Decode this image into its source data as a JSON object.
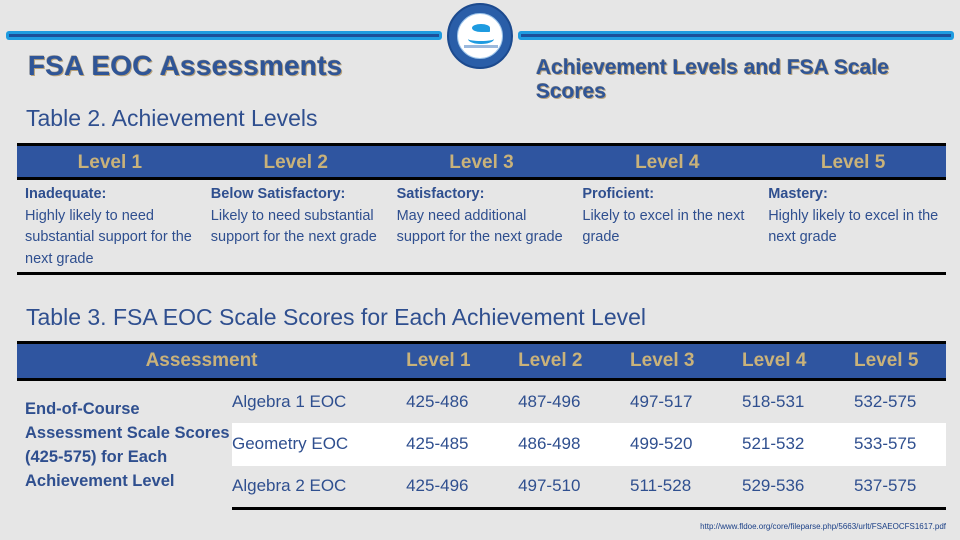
{
  "header": {
    "left_title": "FSA EOC Assessments",
    "right_title": "Achievement Levels and FSA Scale Scores",
    "logo": "school-district-seal-icon"
  },
  "table2": {
    "caption": "Table 2. Achievement Levels",
    "columns": [
      "Level 1",
      "Level 2",
      "Level 3",
      "Level 4",
      "Level 5"
    ],
    "cells": [
      {
        "label": "Inadequate:",
        "text": "Highly likely to need substantial support for the next grade"
      },
      {
        "label": "Below Satisfactory:",
        "text": "Likely to need substantial support for the next grade"
      },
      {
        "label": "Satisfactory:",
        "text": "May need additional support for the next grade"
      },
      {
        "label": "Proficient:",
        "text": "Likely to excel in the next grade"
      },
      {
        "label": "Mastery:",
        "text": "Highly likely to excel in the next grade"
      }
    ]
  },
  "table3": {
    "caption": "Table 3. FSA EOC Scale Scores for Each Achievement Level",
    "columns": [
      "Assessment",
      "Level 1",
      "Level 2",
      "Level 3",
      "Level 4",
      "Level 5"
    ],
    "group_label": "End-of-Course Assessment Scale Scores (425-575) for Each Achievement Level",
    "rows": [
      {
        "course": "Algebra 1 EOC",
        "scores": [
          "425-486",
          "487-496",
          "497-517",
          "518-531",
          "532-575"
        ]
      },
      {
        "course": "Geometry EOC",
        "scores": [
          "425-485",
          "486-498",
          "499-520",
          "521-532",
          "533-575"
        ]
      },
      {
        "course": "Algebra 2 EOC",
        "scores": [
          "425-496",
          "497-510",
          "511-528",
          "529-536",
          "537-575"
        ]
      }
    ]
  },
  "footer": {
    "source_link": "http://www.fldoe.org/core/fileparse.php/5663/urlt/FSAEOCFS1617.pdf"
  },
  "colors": {
    "header_bg": "#2f55a0",
    "header_text": "#c9b27a",
    "body_text": "#2f4f8f",
    "accent_rule": "#1e9be0",
    "page_bg": "#e6e6e6"
  }
}
